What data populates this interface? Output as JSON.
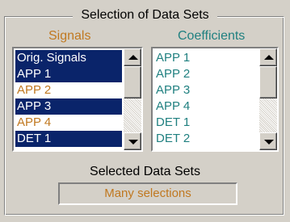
{
  "group": {
    "title": "Selection of Data Sets"
  },
  "signals": {
    "label": "Signals",
    "items": [
      {
        "text": "Orig. Signals",
        "selected": true
      },
      {
        "text": "APP 1",
        "selected": true
      },
      {
        "text": "APP 2",
        "selected": false
      },
      {
        "text": "APP 3",
        "selected": true
      },
      {
        "text": "APP 4",
        "selected": false
      },
      {
        "text": "DET 1",
        "selected": true
      }
    ]
  },
  "coefficients": {
    "label": "Coefficients",
    "items": [
      {
        "text": "APP 1"
      },
      {
        "text": "APP 2"
      },
      {
        "text": "APP 3"
      },
      {
        "text": "APP 4"
      },
      {
        "text": "DET 1"
      },
      {
        "text": "DET 2"
      }
    ]
  },
  "selected": {
    "label": "Selected Data Sets",
    "value": "Many selections"
  },
  "colors": {
    "selection_bg": "#0a246a",
    "signals_text": "#c07820",
    "coefficients_text": "#208080",
    "face": "#d4d0c8"
  }
}
